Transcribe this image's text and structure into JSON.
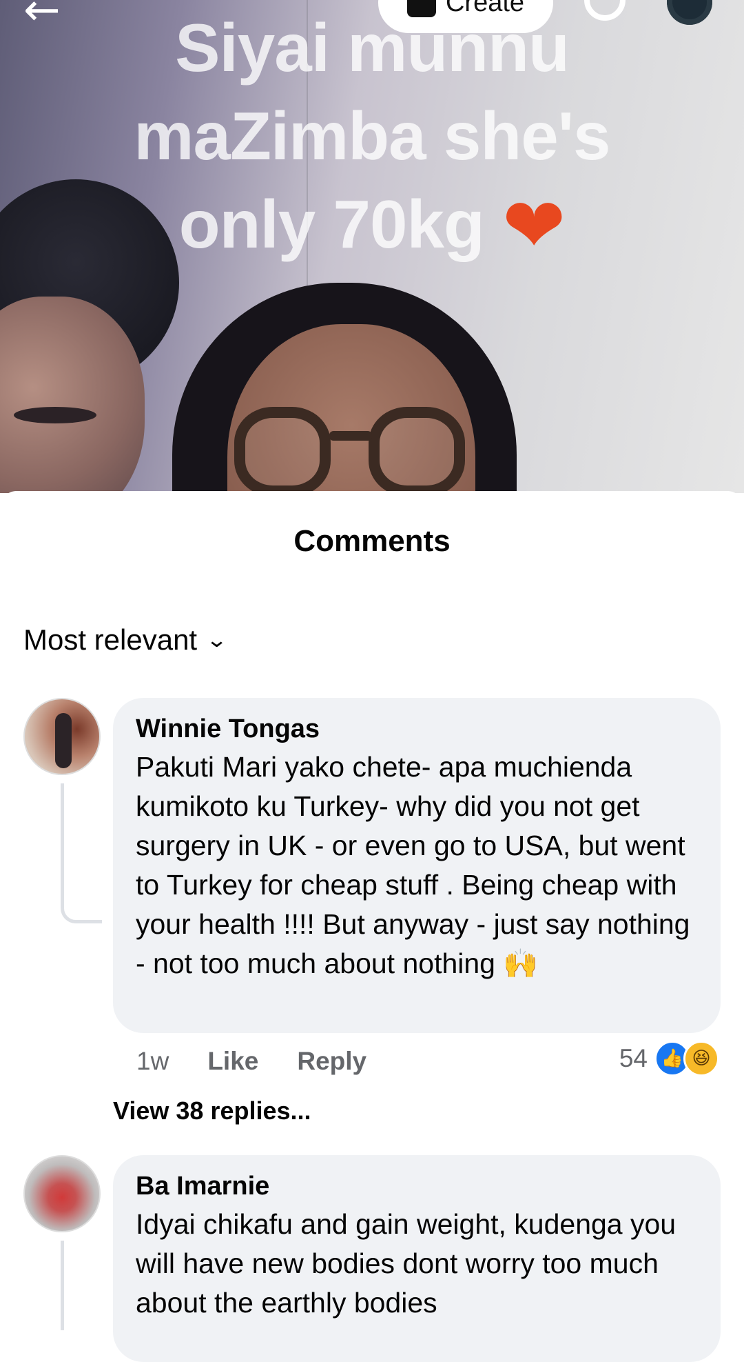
{
  "video": {
    "caption_lines": [
      "Siyai munnu",
      "maZimba she's",
      "only 70kg"
    ],
    "caption_emoji": "❤",
    "create_label": "Create"
  },
  "comments_sheet": {
    "title": "Comments",
    "sort_label": "Most relevant"
  },
  "comments": [
    {
      "author": "Winnie Tongas",
      "text": "Pakuti Mari yako chete- apa muchienda kumikoto ku Turkey- why did you not get surgery in UK - or even go to USA, but went to Turkey for cheap stuff . Being cheap with your health !!!! But anyway - just say  nothing - not too much about nothing 🙌",
      "time": "1w",
      "like_label": "Like",
      "reply_label": "Reply",
      "reaction_count": "54",
      "view_replies": "View 38 replies..."
    },
    {
      "author": "Ba Imarnie",
      "text": "Idyai chikafu and gain weight, kudenga you will have new bodies dont worry too much about the earthly bodies"
    }
  ],
  "colors": {
    "bubble_bg": "#f0f2f5",
    "meta_text": "#65676b",
    "like_blue": "#1877f2",
    "haha_yellow": "#f7b928",
    "heart_red": "#e8481f"
  },
  "icons": [
    "back-arrow-icon",
    "camera-icon",
    "search-icon",
    "profile-icon",
    "chevron-down-icon",
    "like-reaction-icon",
    "haha-reaction-icon"
  ]
}
